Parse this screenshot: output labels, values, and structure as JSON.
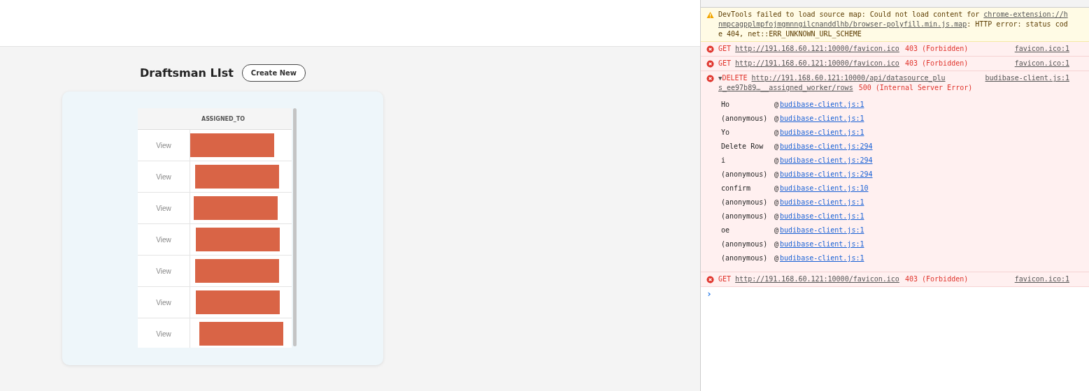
{
  "page": {
    "title": "Draftsman LIst",
    "create_button": "Create New",
    "table": {
      "columns": [
        "ASSIGNED_TO"
      ],
      "rows": [
        {
          "action": "View",
          "redacted": true
        },
        {
          "action": "View",
          "redacted": true
        },
        {
          "action": "View",
          "redacted": true
        },
        {
          "action": "View",
          "redacted": true
        },
        {
          "action": "View",
          "redacted": true
        },
        {
          "action": "View",
          "redacted": true
        },
        {
          "action": "View",
          "redacted": true
        }
      ]
    }
  },
  "console": {
    "messages": [
      {
        "kind": "warning",
        "parts": [
          {
            "link": false,
            "text": "DevTools failed to load source map: Could not load content for "
          },
          {
            "link": true,
            "text": "chrome-extension://hnmpcagpplmpfojmgmnngilcnanddlhb/browser-polyfill.min.js.map"
          },
          {
            "link": false,
            "text": ": HTTP error: status code 404, net::ERR_UNKNOWN_URL_SCHEME"
          }
        ]
      },
      {
        "kind": "error",
        "method": "GET",
        "url_lines": [
          "http://191.168.60.121:10000/favicon.ico"
        ],
        "status": "403 (Forbidden)",
        "source": "favicon.ico:1"
      },
      {
        "kind": "error",
        "method": "GET",
        "url_lines": [
          "http://191.168.60.121:10000/favicon.ico"
        ],
        "status": "403 (Forbidden)",
        "source": "favicon.ico:1"
      },
      {
        "kind": "error",
        "toggle": "▼",
        "expanded": true,
        "method": "DELETE",
        "url_lines": [
          "http://191.168.60.121:10000/api/datasource_plu",
          "s_ee97b89…__assigned_worker/rows"
        ],
        "status": "500 (Internal Server Error)",
        "source": "budibase-client.js:1",
        "stack": [
          {
            "fn": "Ho",
            "at": "@",
            "link": "budibase-client.js:1"
          },
          {
            "fn": "(anonymous)",
            "at": "@",
            "link": "budibase-client.js:1"
          },
          {
            "fn": "Yo",
            "at": "@",
            "link": "budibase-client.js:1"
          },
          {
            "fn": "Delete Row",
            "at": "@",
            "link": "budibase-client.js:294"
          },
          {
            "fn": "i",
            "at": "@",
            "link": "budibase-client.js:294"
          },
          {
            "fn": "(anonymous)",
            "at": "@",
            "link": "budibase-client.js:294"
          },
          {
            "fn": "confirm",
            "at": "@",
            "link": "budibase-client.js:10"
          },
          {
            "fn": "(anonymous)",
            "at": "@",
            "link": "budibase-client.js:1"
          },
          {
            "fn": "(anonymous)",
            "at": "@",
            "link": "budibase-client.js:1"
          },
          {
            "fn": "oe",
            "at": "@",
            "link": "budibase-client.js:1"
          },
          {
            "fn": "(anonymous)",
            "at": "@",
            "link": "budibase-client.js:1"
          },
          {
            "fn": "(anonymous)",
            "at": "@",
            "link": "budibase-client.js:1"
          }
        ]
      },
      {
        "kind": "error",
        "method": "GET",
        "url_lines": [
          "http://191.168.60.121:10000/favicon.ico"
        ],
        "status": "403 (Forbidden)",
        "source": "favicon.ico:1"
      },
      {
        "kind": "prompt",
        "text": "›"
      }
    ]
  }
}
